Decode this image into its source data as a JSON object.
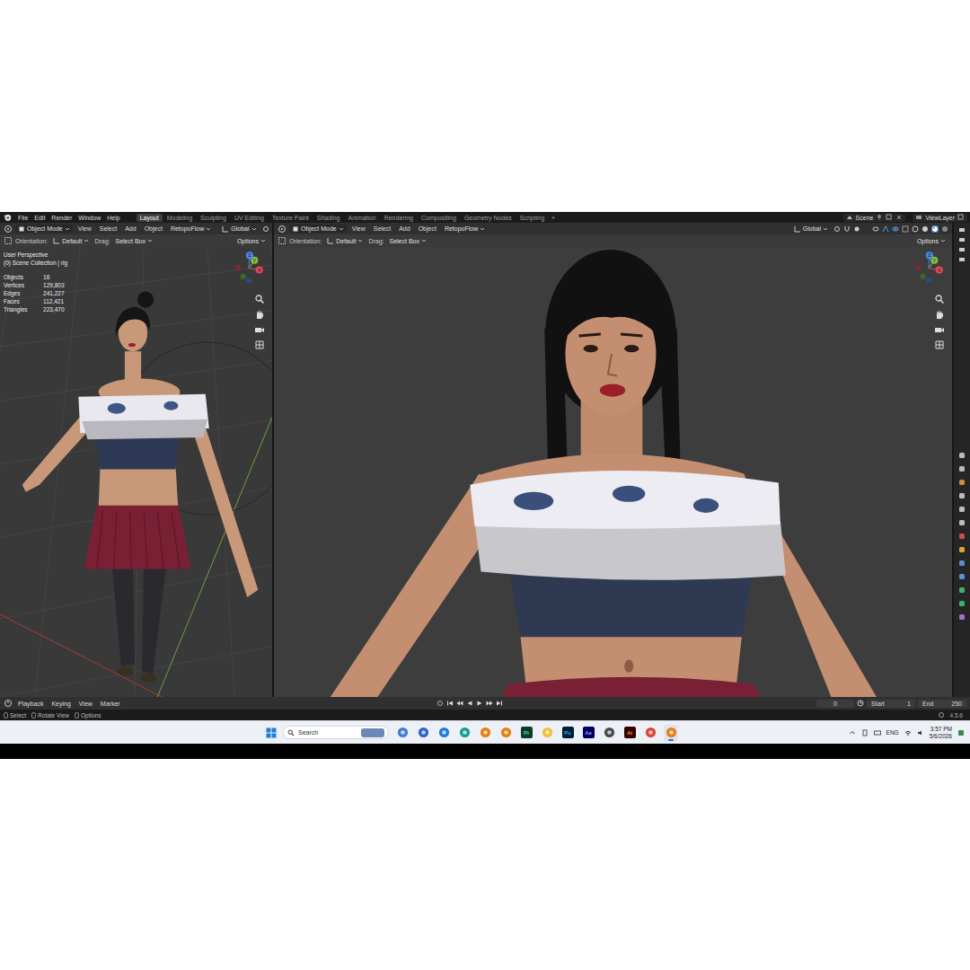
{
  "topbar": {
    "menus": [
      "File",
      "Edit",
      "Render",
      "Window",
      "Help"
    ],
    "workspaces": [
      {
        "label": "Layout",
        "selected": true
      },
      {
        "label": "Modeling",
        "selected": false
      },
      {
        "label": "Sculpting",
        "selected": false
      },
      {
        "label": "UV Editing",
        "selected": false
      },
      {
        "label": "Texture Paint",
        "selected": false
      },
      {
        "label": "Shading",
        "selected": false
      },
      {
        "label": "Animation",
        "selected": false
      },
      {
        "label": "Rendering",
        "selected": false
      },
      {
        "label": "Compositing",
        "selected": false
      },
      {
        "label": "Geometry Nodes",
        "selected": false
      },
      {
        "label": "Scripting",
        "selected": false
      }
    ],
    "add_workspace": "+",
    "scene": "Scene",
    "view_layer": "ViewLayer"
  },
  "viewports": [
    {
      "kind": "full",
      "mode": "Object Mode",
      "menus": [
        "View",
        "Select",
        "Add",
        "Object"
      ],
      "addon": "RetopoFlow",
      "transform": "Global",
      "orientation_label": "Orientation:",
      "orientation": "Default",
      "drag_label": "Drag:",
      "drag": "Select Box",
      "options": "Options",
      "overlay": {
        "view_name": "User Perspective",
        "collection": "(0) Scene Collection | rig",
        "stats": [
          {
            "label": "Objects",
            "value": "16"
          },
          {
            "label": "Vertices",
            "value": "129,803"
          },
          {
            "label": "Edges",
            "value": "241,227"
          },
          {
            "label": "Faces",
            "value": "112,421"
          },
          {
            "label": "Triangles",
            "value": "223,470"
          }
        ]
      },
      "axes": [
        "X",
        "Y",
        "Z"
      ]
    },
    {
      "kind": "close",
      "mode": "Object Mode",
      "menus": [
        "View",
        "Select",
        "Add",
        "Object"
      ],
      "addon": "RetopoFlow",
      "transform": "Global",
      "orientation_label": "Orientation:",
      "orientation": "Default",
      "drag_label": "Drag:",
      "drag": "Select Box",
      "options": "Options",
      "axes": [
        "X",
        "Y",
        "Z"
      ]
    }
  ],
  "timeline": {
    "menus": [
      "Playback",
      "Keying",
      "View",
      "Marker"
    ],
    "current_frame": "0",
    "start_label": "Start",
    "start": "1",
    "end_label": "End",
    "end": "250"
  },
  "status_bar": {
    "hints": [
      "Select",
      "Rotate View",
      "Options"
    ],
    "version": "4.5.6"
  },
  "taskbar": {
    "search": "Search",
    "language": "ENG",
    "time": "3:57 PM",
    "date": "5/6/2026",
    "apps": [
      {
        "kind": "icon",
        "color": "#3f7bd0",
        "selected": false
      },
      {
        "kind": "icon",
        "color": "#2d63c8",
        "selected": false
      },
      {
        "kind": "icon",
        "color": "#1f7ad8",
        "selected": false
      },
      {
        "kind": "icon",
        "color": "#1a9c8c",
        "selected": false
      },
      {
        "kind": "icon",
        "color": "#e87d0d",
        "selected": false
      },
      {
        "kind": "icon",
        "color": "#e87d0d",
        "selected": false
      },
      {
        "kind": "letters",
        "label": "Pt",
        "color": "#0c3b2c",
        "text_color": "#3fe0a0",
        "selected": false
      },
      {
        "kind": "icon",
        "color": "#f0c030",
        "selected": false
      },
      {
        "kind": "letters",
        "label": "Ps",
        "color": "#001e36",
        "text_color": "#31a8ff",
        "selected": false
      },
      {
        "kind": "letters",
        "label": "Ae",
        "color": "#00005b",
        "text_color": "#9999ff",
        "selected": false
      },
      {
        "kind": "icon",
        "color": "#4a4a4a",
        "selected": false
      },
      {
        "kind": "letters",
        "label": "Ai",
        "color": "#330000",
        "text_color": "#ff9a00",
        "selected": false
      },
      {
        "kind": "icon",
        "color": "#db4437",
        "selected": false
      },
      {
        "kind": "icon",
        "color": "#e87d0d",
        "selected": true
      }
    ]
  }
}
